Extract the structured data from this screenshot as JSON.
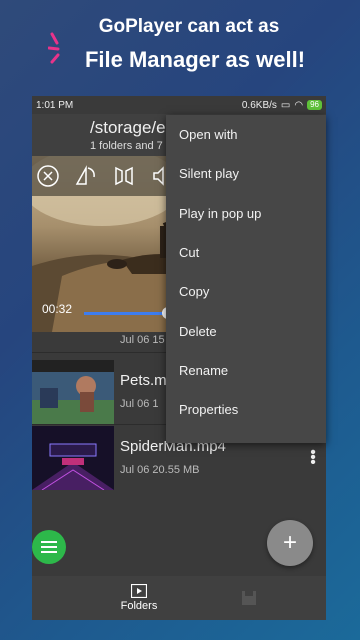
{
  "promo": {
    "line1": "GoPlayer can act as",
    "line2": "File Manager as well!",
    "sparkle_color": "#e8338a"
  },
  "status_bar": {
    "time": "1:01 PM",
    "speed": "0.6KB/s",
    "battery": "96"
  },
  "header": {
    "path": "/storage/em",
    "count": "1 folders and 7 fil"
  },
  "video": {
    "elapsed": "00:32",
    "progress": 0.35
  },
  "files": [
    {
      "name": "",
      "meta": "Jul 06   15"
    },
    {
      "name": "Pets.mp",
      "meta": "Jul 06   1"
    },
    {
      "name": "SpiderMan.mp4",
      "meta": "Jul 06   20.55 MB"
    }
  ],
  "context_menu": [
    "Open with",
    "Silent play",
    "Play in pop up",
    "Cut",
    "Copy",
    "Delete",
    "Rename",
    "Properties"
  ],
  "bottom_nav": {
    "folders_label": "Folders"
  },
  "colors": {
    "accent_blue": "#3d7df0",
    "fab_green": "#2db84a",
    "battery_green": "#5fc13a"
  }
}
